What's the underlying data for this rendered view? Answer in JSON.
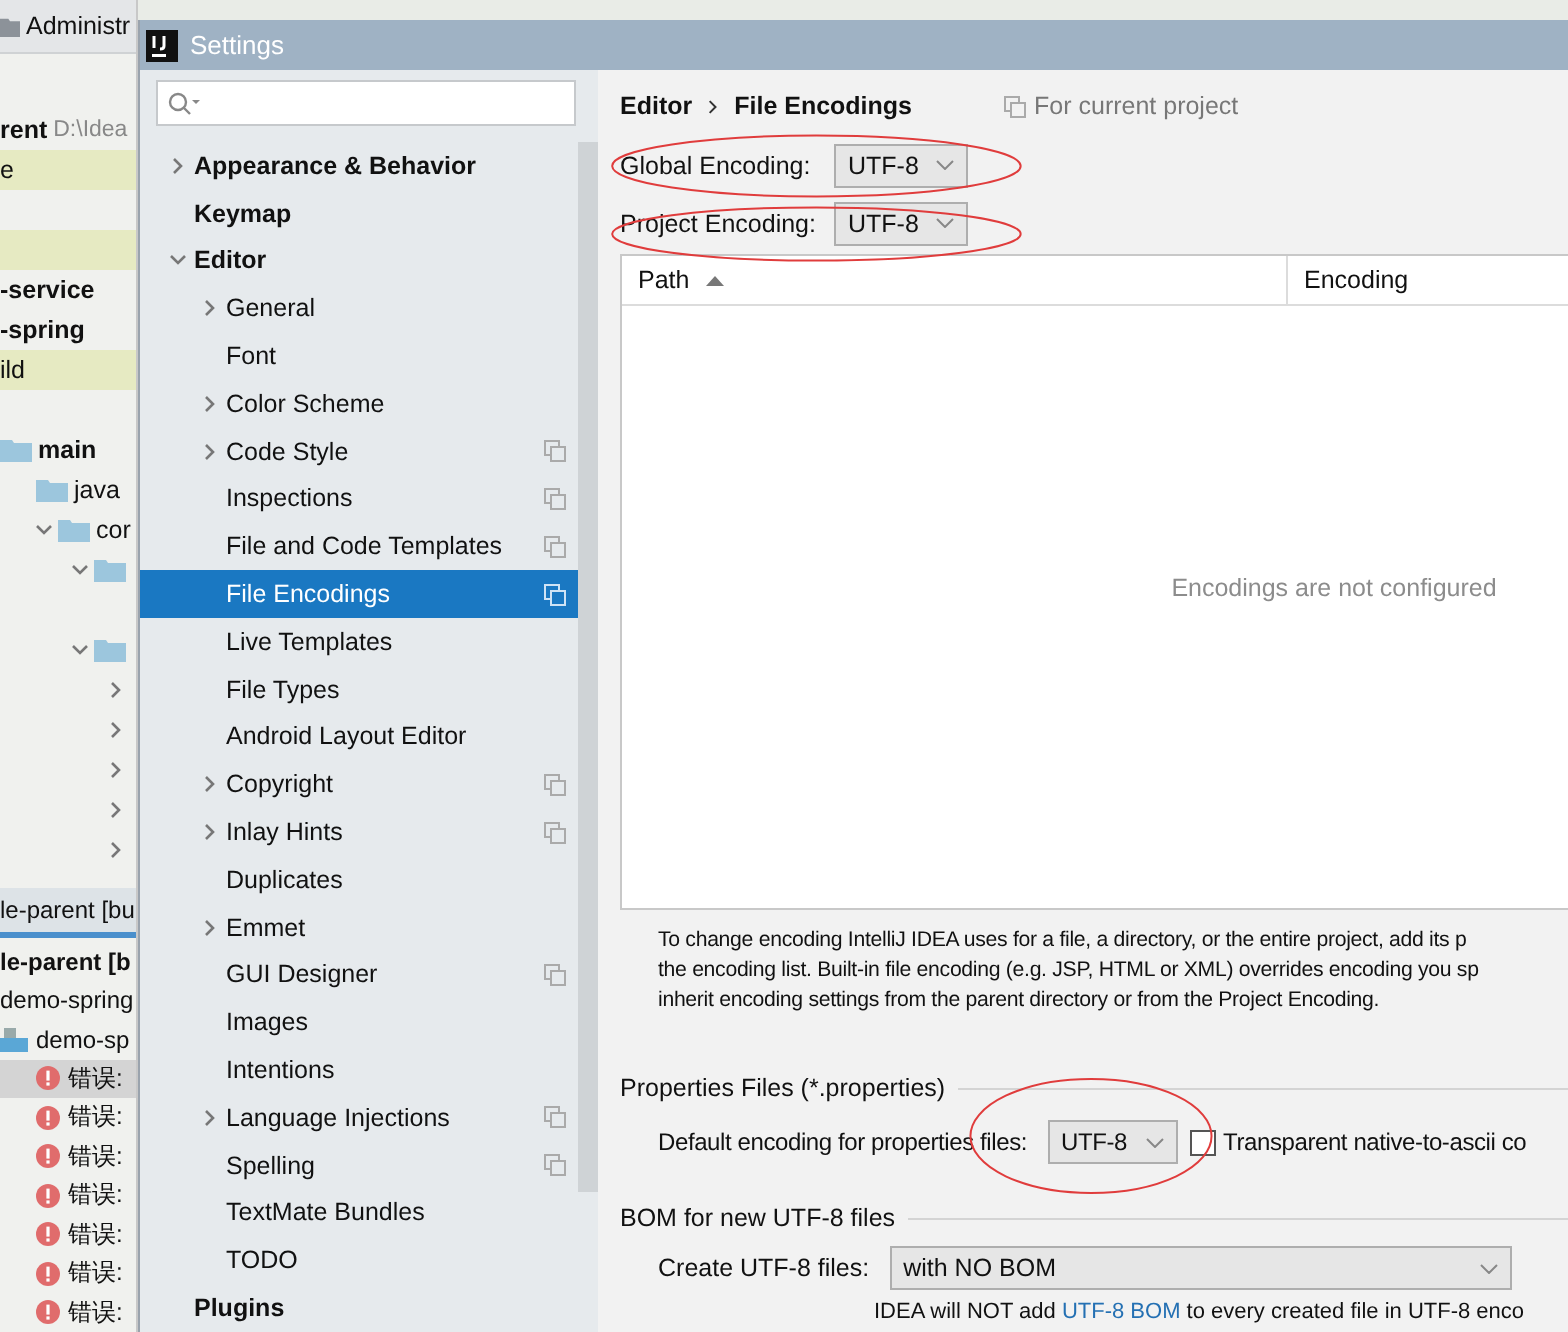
{
  "background_ide": {
    "header": "Administr",
    "tree": [
      {
        "text": "rent",
        "note": "D:\\Idea",
        "bold": true,
        "highlighted": false
      },
      {
        "text": "e",
        "highlighted": true
      },
      {
        "kind": "blank"
      },
      {
        "kind": "blank",
        "highlighted": true
      },
      {
        "text": "-service",
        "bold": true,
        "highlighted": false
      },
      {
        "text": "-spring",
        "bold": true,
        "highlighted": false
      },
      {
        "text": "ild",
        "highlighted": true
      },
      {
        "kind": "blank"
      },
      {
        "kind": "folder",
        "text": "main",
        "bold": true,
        "highlighted": false,
        "children": [
          {
            "kind": "folder",
            "text": "java",
            "highlighted": false
          },
          {
            "kind": "folder",
            "text": "cor",
            "expanded": true,
            "highlighted": false,
            "children": [
              {
                "kind": "folder",
                "expanded": true,
                "highlighted": false
              },
              {
                "kind": "blank"
              },
              {
                "kind": "folder",
                "expanded": true,
                "highlighted": false,
                "children": [
                  {
                    "expanded": false,
                    "highlighted": false
                  },
                  {
                    "expanded": false,
                    "highlighted": false
                  },
                  {
                    "expanded": false,
                    "highlighted": false
                  },
                  {
                    "expanded": false,
                    "highlighted": false
                  },
                  {
                    "expanded": false,
                    "highlighted": false
                  }
                ]
              }
            ]
          }
        ]
      }
    ],
    "build_tab": "le-parent [bu",
    "build_tree": [
      {
        "text": "le-parent [b",
        "bold": true,
        "selected": false
      },
      {
        "text": "demo-spring",
        "selected": false
      },
      {
        "kind": "module",
        "text": "demo-sp",
        "selected": false,
        "children": [
          {
            "kind": "error",
            "text": "错误:",
            "selected": true
          },
          {
            "kind": "error",
            "text": "错误:",
            "selected": false
          },
          {
            "kind": "error",
            "text": "错误:",
            "selected": false
          },
          {
            "kind": "error",
            "text": "错误:",
            "selected": false
          },
          {
            "kind": "error",
            "text": "错误:",
            "selected": false
          },
          {
            "kind": "error",
            "text": "错误:",
            "selected": false
          },
          {
            "kind": "error",
            "text": "错误:",
            "selected": false
          }
        ]
      }
    ]
  },
  "window": {
    "title": "Settings"
  },
  "sidebar": {
    "items": [
      {
        "label": "Appearance & Behavior",
        "expanded": false,
        "selected": false
      },
      {
        "label": "Keymap",
        "selected": false
      },
      {
        "label": "Editor",
        "expanded": true,
        "selected": false,
        "children": [
          {
            "label": "General",
            "expanded": false,
            "selected": false
          },
          {
            "label": "Font",
            "selected": false
          },
          {
            "label": "Color Scheme",
            "expanded": false,
            "selected": false
          },
          {
            "label": "Code Style",
            "expanded": false,
            "selected": false,
            "project_level": true
          },
          {
            "label": "Inspections",
            "selected": false,
            "project_level": true
          },
          {
            "label": "File and Code Templates",
            "selected": false,
            "project_level": true
          },
          {
            "label": "File Encodings",
            "selected": true,
            "project_level": true
          },
          {
            "label": "Live Templates",
            "selected": false
          },
          {
            "label": "File Types",
            "selected": false
          },
          {
            "label": "Android Layout Editor",
            "selected": false
          },
          {
            "label": "Copyright",
            "expanded": false,
            "selected": false,
            "project_level": true
          },
          {
            "label": "Inlay Hints",
            "expanded": false,
            "selected": false,
            "project_level": true
          },
          {
            "label": "Duplicates",
            "selected": false
          },
          {
            "label": "Emmet",
            "expanded": false,
            "selected": false
          },
          {
            "label": "GUI Designer",
            "selected": false,
            "project_level": true
          },
          {
            "label": "Images",
            "selected": false
          },
          {
            "label": "Intentions",
            "selected": false
          },
          {
            "label": "Language Injections",
            "expanded": false,
            "selected": false,
            "project_level": true
          },
          {
            "label": "Spelling",
            "selected": false,
            "project_level": true
          },
          {
            "label": "TextMate Bundles",
            "selected": false
          },
          {
            "label": "TODO",
            "selected": false
          }
        ]
      },
      {
        "label": "Plugins",
        "selected": false
      }
    ]
  },
  "breadcrumb": [
    "Editor",
    "File Encodings"
  ],
  "scope_note": "For current project",
  "encodings": [
    {
      "label": "Global Encoding:",
      "value": "UTF-8",
      "highlighted": true
    },
    {
      "label": "Project Encoding:",
      "value": "UTF-8",
      "highlighted": true
    }
  ],
  "table": {
    "columns": [
      {
        "label": "Path",
        "sorted": true
      },
      {
        "label": "Encoding",
        "sorted": false
      }
    ],
    "empty_text": "Encodings are not configured"
  },
  "description": [
    "To change encoding IntelliJ IDEA uses for a file, a directory, or the entire project, add its p",
    "the encoding list. Built-in file encoding (e.g. JSP, HTML or XML) overrides encoding you sp",
    "inherit encoding settings from the parent directory or from the Project Encoding."
  ],
  "properties": {
    "title": "Properties Files (*.properties)",
    "label": "Default encoding for properties files:",
    "value": "UTF-8",
    "highlighted": true,
    "checkbox": {
      "label": "Transparent native-to-ascii co",
      "checked": false
    }
  },
  "bom": {
    "title": "BOM for new UTF-8 files",
    "label": "Create UTF-8 files:",
    "value": "with NO BOM",
    "note_before": "IDEA will NOT add ",
    "note_link": "UTF-8 BOM",
    "note_after": " to every created file in UTF-8 enco"
  }
}
